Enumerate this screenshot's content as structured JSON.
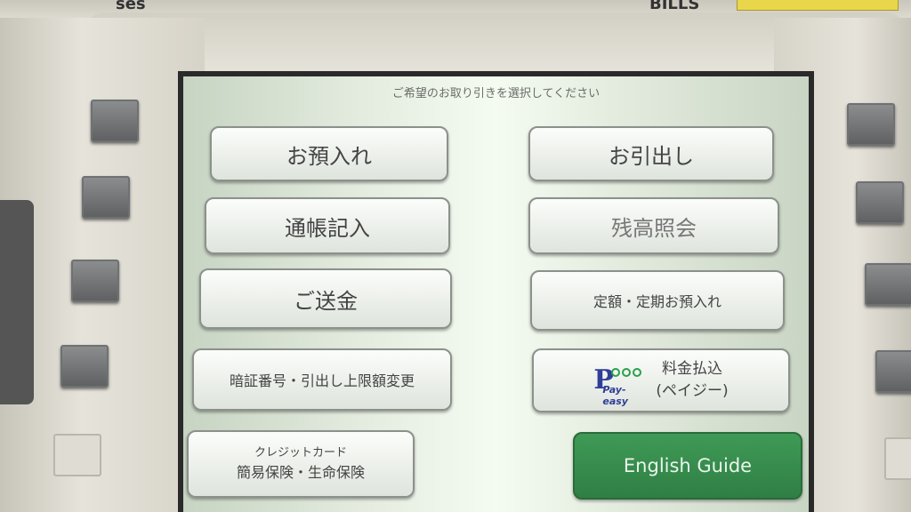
{
  "bezel": {
    "top_left_text": "ses",
    "top_right_text": "BILLS"
  },
  "screen": {
    "instruction": "ご希望のお取り引きを選択してください",
    "buttons": {
      "deposit": "お預入れ",
      "withdrawal": "お引出し",
      "passbook": "通帳記入",
      "balance": "残高照会",
      "transfer": "ご送金",
      "fixed_deposit": "定額・定期お預入れ",
      "pin_change": "暗証番号・引出し上限額変更",
      "payeasy_line1": "料金払込",
      "payeasy_line2": "(ペイジー)",
      "payeasy_logo": "Pay-easy",
      "insurance_line1": "クレジットカード",
      "insurance_line2": "簡易保険・生命保険",
      "english": "English Guide"
    }
  },
  "colors": {
    "english_button": "#2f7f44",
    "payeasy_blue": "#2f3f97",
    "payeasy_green": "#2aa04a"
  }
}
